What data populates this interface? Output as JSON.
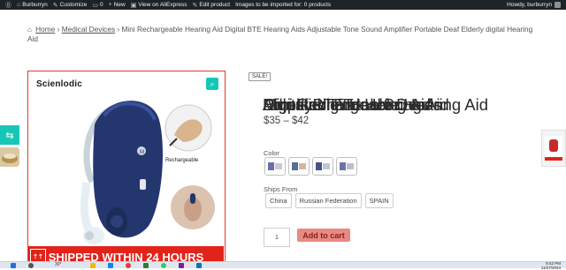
{
  "admin_bar": {
    "site_name": "Burburryn",
    "customize": "Customize",
    "comments_count": "0",
    "new": "New",
    "view_on_aliexpress": "View on AliExpress",
    "edit_product": "Edit product",
    "import_status": "Images to be imported for: 0 products",
    "greeting": "Howdy, burburryn"
  },
  "breadcrumb": {
    "home": "Home",
    "category": "Medical Devices",
    "current": "Mini Rechargeable Hearing Aid Digital BTE Hearing Aids Adjustable Tone Sound Amplifier Portable Deaf Elderly digital Hearing Aid"
  },
  "gallery": {
    "brand": "Scienlodic",
    "rechargeable_label": "Rechargeable",
    "shipping_banner": "SHIPPED WITHIN 24 HOURS"
  },
  "product": {
    "sale_badge": "SALE!",
    "title_layers": [
      "Mini Rechargeable Hearing Aid",
      "Digital BTE Hearing Aids",
      "Adjustable Tone Sound",
      "Amplifier Portable Deaf",
      "Elderly digital Hearing Aid"
    ],
    "price": "$35 – $42",
    "color_label": "Color",
    "ships_from_label": "Ships From",
    "ships_from_options": [
      "China",
      "Russian Federation",
      "SPAIN"
    ],
    "quantity": "1",
    "add_to_cart": "Add to cart"
  },
  "taskbar": {
    "weather": "30°",
    "time": "8:42 PM",
    "date": "11/27/2024"
  },
  "colors": {
    "admin_bar": "#1d2327",
    "accent_teal": "#16c7b7",
    "brand_red": "#e2231a",
    "add_to_cart_bg": "#e88a84"
  }
}
